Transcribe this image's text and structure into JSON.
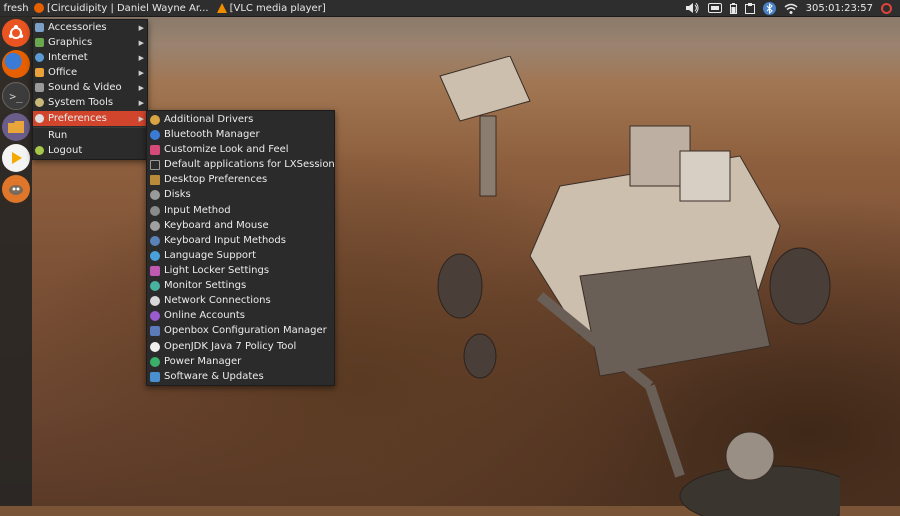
{
  "top_panel": {
    "menu_label": "fresh",
    "tasks": [
      {
        "label": "[Circuidipity | Daniel Wayne Ar...",
        "icon": "firefox-icon",
        "color": "#e66000"
      },
      {
        "label": "[VLC media player]",
        "icon": "vlc-icon",
        "color": "#f08c00"
      }
    ],
    "tray": {
      "clock": "305:01:23:57"
    }
  },
  "launcher": [
    {
      "name": "ubuntu-logo-icon",
      "color": "#e95420"
    },
    {
      "name": "firefox-icon",
      "color": "#e66000"
    },
    {
      "name": "terminal-icon",
      "color": "#3a3a3a"
    },
    {
      "name": "files-icon",
      "color": "#6a5d8a"
    },
    {
      "name": "media-player-icon",
      "color": "#f0f0f0"
    },
    {
      "name": "gimp-icon",
      "color": "#e0762a"
    }
  ],
  "main_menu": [
    {
      "label": "Accessories",
      "icon": "accessories-icon",
      "color": "#7aa0c8",
      "submenu": true
    },
    {
      "label": "Graphics",
      "icon": "graphics-icon",
      "color": "#6aa84f",
      "submenu": true
    },
    {
      "label": "Internet",
      "icon": "internet-icon",
      "color": "#5b9bd5",
      "submenu": true
    },
    {
      "label": "Office",
      "icon": "office-icon",
      "color": "#e9a13b",
      "submenu": true
    },
    {
      "label": "Sound & Video",
      "icon": "sound-video-icon",
      "color": "#9a9a9a",
      "submenu": true
    },
    {
      "label": "System Tools",
      "icon": "system-tools-icon",
      "color": "#c9b87a",
      "submenu": true
    },
    {
      "label": "Preferences",
      "icon": "preferences-icon",
      "color": "#e0e0e0",
      "submenu": true,
      "active": true
    },
    {
      "label": "Run",
      "icon": "",
      "color": "",
      "submenu": false
    },
    {
      "label": "Logout",
      "icon": "logout-icon",
      "color": "#a6c84a",
      "submenu": false
    }
  ],
  "preferences_menu": [
    {
      "label": "Additional Drivers",
      "icon": "drivers-icon",
      "color": "#d9a441"
    },
    {
      "label": "Bluetooth Manager",
      "icon": "bluetooth-icon",
      "color": "#3a7bd5"
    },
    {
      "label": "Customize Look and Feel",
      "icon": "appearance-icon",
      "color": "#d64a7a"
    },
    {
      "label": "Default applications for LXSession",
      "icon": "default-apps-icon",
      "color": "#555555"
    },
    {
      "label": "Desktop Preferences",
      "icon": "desktop-icon",
      "color": "#b88a3a"
    },
    {
      "label": "Disks",
      "icon": "disks-icon",
      "color": "#9a9a9a"
    },
    {
      "label": "Input Method",
      "icon": "input-method-icon",
      "color": "#8a8a8a"
    },
    {
      "label": "Keyboard and Mouse",
      "icon": "keyboard-mouse-icon",
      "color": "#a0a0a0"
    },
    {
      "label": "Keyboard Input Methods",
      "icon": "keyboard-icon",
      "color": "#5a82b8"
    },
    {
      "label": "Language Support",
      "icon": "language-icon",
      "color": "#4aa0d8"
    },
    {
      "label": "Light Locker Settings",
      "icon": "lock-icon",
      "color": "#c05ab0"
    },
    {
      "label": "Monitor Settings",
      "icon": "monitor-icon",
      "color": "#4ab0a0"
    },
    {
      "label": "Network Connections",
      "icon": "network-icon",
      "color": "#d8d8d8"
    },
    {
      "label": "Online Accounts",
      "icon": "online-accounts-icon",
      "color": "#9a5ad0"
    },
    {
      "label": "Openbox Configuration Manager",
      "icon": "openbox-icon",
      "color": "#5a7ab8"
    },
    {
      "label": "OpenJDK Java 7 Policy Tool",
      "icon": "java-icon",
      "color": "#f0f0f0"
    },
    {
      "label": "Power Manager",
      "icon": "power-manager-icon",
      "color": "#3ab06a"
    },
    {
      "label": "Software & Updates",
      "icon": "software-updates-icon",
      "color": "#4a90d0"
    }
  ]
}
